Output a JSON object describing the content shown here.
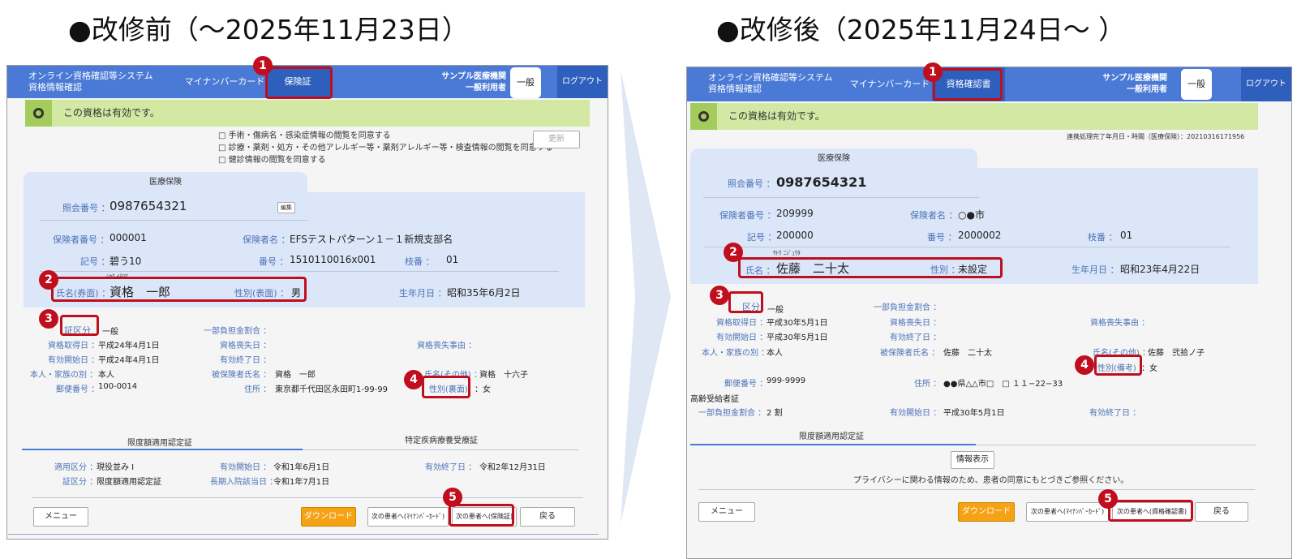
{
  "headings": {
    "before": "●改修前（～2025年11月23日）",
    "after": "●改修後（2025年11月24日～ ）"
  },
  "colors": {
    "accent": "#4a7ad6",
    "highlight": "#c00e1e",
    "valid_bg": "#d2e8a3",
    "panel_bg": "#dbe6f8",
    "download": "#f5a214"
  },
  "before": {
    "system_title": [
      "オンライン資格確認等システム",
      "資格情報確認"
    ],
    "nav_mynumber": "マイナンバーカード",
    "nav_active": "保険証",
    "org_name": "サンプル医療機関",
    "user_role": "一般利用者",
    "user_badge": "一般",
    "logout": "ログアウト",
    "valid_msg": "この資格は有効です。",
    "consents": [
      "□ 手術・傷病名・感染症情報の閲覧を同意する",
      "□ 診療・薬剤・処方・その他アレルギー等・薬剤アレルギー等・検査情報の閲覧を同意する",
      "□ 健診情報の閲覧を同意する"
    ],
    "update_btn": "更新",
    "panel_tab": "医療保険",
    "ref_label": "照会番号 ：",
    "ref_value": "0987654321",
    "edit_btn": "編集",
    "insurer_no_label": "保険者番号 ：",
    "insurer_no": "000001",
    "insurer_name_label": "保険者名 ：",
    "insurer_name": "EFSテストパターン１－１新規支部名",
    "symbol_label": "記号 ：",
    "symbol": "碧う10",
    "number_label": "番号 ：",
    "number": "1510110016x001",
    "branch_label": "枝番 ：",
    "branch": "01",
    "kana": "ｼｶｸ ｲﾁﾛｳ",
    "name_label": "氏名(券面) ：",
    "name": "資格　一郎",
    "sex_label": "性別(表面) ：",
    "sex": "男",
    "dob_label": "生年月日 ：",
    "dob": "昭和35年6月2日",
    "class_label": "証区分",
    "class_value": "一般",
    "copay_label": "一部負担金割合 ：",
    "acq_label": "資格取得日 ：",
    "acq": "平成24年4月1日",
    "loss_label": "資格喪失日 ：",
    "loss_reason_label": "資格喪失事由 ：",
    "start_label": "有効開始日 ：",
    "start": "平成24年4月1日",
    "end_label": "有効終了日 ：",
    "family_label": "本人・家族の別 ：",
    "family": "本人",
    "insured_label": "被保険者氏名 ：",
    "insured": "資格　一郎",
    "other_name_label": "氏名(その他) ：",
    "other_name": "資格　十六子",
    "postal_label": "郵便番号 ：",
    "postal": "100-0014",
    "address_label": "住所 ：",
    "address": "東京都千代田区永田町1-99-99",
    "sex_back_label": "性別(裏面)",
    "sex_back": "：女",
    "tab1": "限度額適用認定証",
    "tab2": "特定疾病療養受療証",
    "apply_label": "適用区分 ：",
    "apply": "現役並み I",
    "lstart_label": "有効開始日 ：",
    "lstart": "令和1年6月1日",
    "lend_label": "有効終了日 ：",
    "lend": "令和2年12月31日",
    "lclass_label": "証区分 ：",
    "lclass": "限度額適用認定証",
    "long_label": "長期入院該当日 ：",
    "long": "令和1年7月1日",
    "menu_btn": "メニュー",
    "download_btn": "ダウンロード",
    "next_mynumber_btn": "次の患者へ(ﾏｲﾅﾝﾊﾞｰｶｰﾄﾞ)",
    "next_cert_btn": "次の患者へ(保険証)",
    "back_btn": "戻る"
  },
  "after": {
    "system_title": [
      "オンライン資格確認等システム",
      "資格情報確認"
    ],
    "nav_mynumber": "マイナンバーカード",
    "nav_active": "資格確認書",
    "org_name": "サンプル医療機関",
    "user_role": "一般利用者",
    "user_badge": "一般",
    "logout": "ログアウト",
    "valid_msg": "この資格は有効です。",
    "linkage": "連携処理完了年月日・時間（医療保険）：20210316171956",
    "panel_tab": "医療保険",
    "ref_label": "照会番号 ：",
    "ref_value": "0987654321",
    "insurer_no_label": "保険者番号 ：",
    "insurer_no": "209999",
    "insurer_name_label": "保険者名 ：",
    "insurer_name": "○●市",
    "symbol_label": "記号 ：",
    "symbol": "200000",
    "number_label": "番号 ：",
    "number": "2000002",
    "branch_label": "枝番 ：",
    "branch": "01",
    "kana": "ｻﾄｳ ﾆｼﾞｭｳﾀ",
    "name_label": "氏名 ：",
    "name": "佐藤　二十太",
    "sex_label": "性別 ：",
    "sex": "未設定",
    "dob_label": "生年月日 ：",
    "dob": "昭和23年4月22日",
    "class_label": "区分",
    "class_value": "一般",
    "copay_label": "一部負担金割合 ：",
    "acq_label": "資格取得日 ：",
    "acq": "平成30年5月1日",
    "loss_label": "資格喪失日 ：",
    "loss_reason_label": "資格喪失事由 ：",
    "start_label": "有効開始日 ：",
    "start": "平成30年5月1日",
    "end_label": "有効終了日 ：",
    "family_label": "本人・家族の別 ：",
    "family": "本人",
    "insured_label": "被保険者氏名 ：",
    "insured": "佐藤　二十太",
    "other_name_label": "氏名(その他) ：",
    "other_name": "佐藤　弐拾ノ子",
    "sex_note_label": "性別(備考)",
    "sex_note": "：女",
    "postal_label": "郵便番号 ：",
    "postal": "999-9999",
    "address_label": "住所 ：",
    "address": "●●県△△市□　□ １１−22−33",
    "elderly_title": "高齢受給者証",
    "e_copay_label": "一部負担金割合 ：",
    "e_copay": "2 割",
    "e_start_label": "有効開始日 ：",
    "e_start": "平成30年5月1日",
    "e_end_label": "有効終了日 ：",
    "tab1": "限度額適用認定証",
    "info_btn": "情報表示",
    "privacy": "プライバシーに関わる情報のため、患者の同意にもとづきご参照ください。",
    "menu_btn": "メニュー",
    "download_btn": "ダウンロード",
    "next_mynumber_btn": "次の患者へ(ﾏｲﾅﾝﾊﾞｰｶｰﾄﾞ)",
    "next_cert_btn": "次の患者へ(資格確認書)",
    "back_btn": "戻る"
  },
  "badges": [
    "1",
    "2",
    "3",
    "4",
    "5"
  ]
}
